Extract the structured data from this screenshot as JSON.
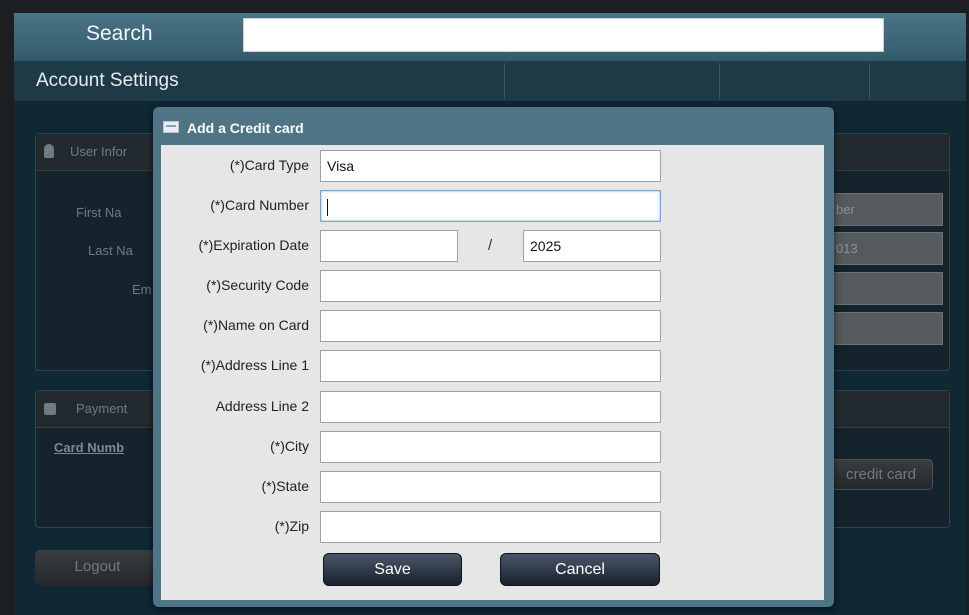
{
  "topbar": {
    "search_label": "Search",
    "search_value": ""
  },
  "nav": {
    "title": "Account Settings"
  },
  "background": {
    "user_info_header": "User Infor",
    "first_name_label": "First Na",
    "last_name_label": "Last Na",
    "email_label": "Em",
    "field_value_1": "ber",
    "field_value_2": "013",
    "payment_header": "Payment",
    "card_number_header": "Card Numb",
    "add_credit_card_button": "credit card",
    "logout_button": "Logout"
  },
  "modal": {
    "title": "Add a Credit card",
    "fields": {
      "card_type": {
        "label": "(*)Card Type",
        "value": "Visa"
      },
      "card_number": {
        "label": "(*)Card Number",
        "value": ""
      },
      "expiration_date": {
        "label": "(*)Expiration Date",
        "month": "",
        "separator": "/",
        "year": "2025"
      },
      "security_code": {
        "label": "(*)Security Code",
        "value": ""
      },
      "name_on_card": {
        "label": "(*)Name on Card",
        "value": ""
      },
      "address_line_1": {
        "label": "(*)Address Line 1",
        "value": ""
      },
      "address_line_2": {
        "label": "Address Line 2",
        "value": ""
      },
      "city": {
        "label": "(*)City",
        "value": ""
      },
      "state": {
        "label": "(*)State",
        "value": ""
      },
      "zip": {
        "label": "(*)Zip",
        "value": ""
      }
    },
    "save_label": "Save",
    "cancel_label": "Cancel"
  },
  "colors": {
    "topbar": "#3f6a7b",
    "modal_header": "#4f7485",
    "modal_body": "#e6e6e6",
    "button_dark": "#1a2130"
  },
  "icons": {
    "modal_title_icon": "card-icon",
    "user_panel_icon": "user-icon",
    "payment_panel_icon": "lock-icon"
  }
}
